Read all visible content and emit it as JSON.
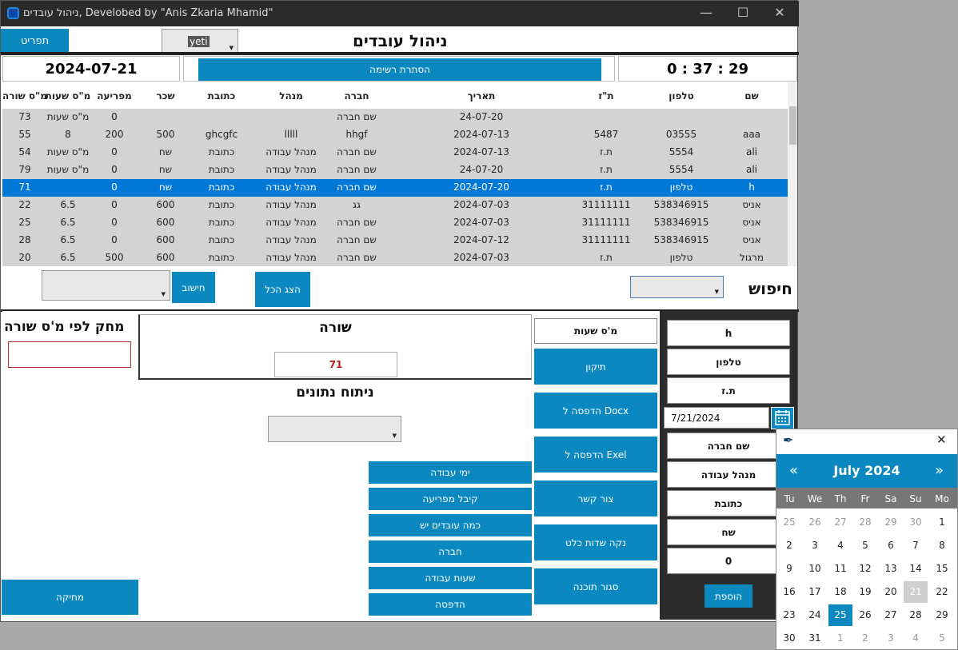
{
  "window": {
    "title": "ניהול עובדים, Develobed by \"Anis Zkaria Mhamid\""
  },
  "top": {
    "menu_button": "תפריט",
    "combo_value": "yeti",
    "app_title": "ניהול עובדים"
  },
  "info": {
    "date": "2024-07-21",
    "toggle_button": "הסתרת רשימה",
    "clock": "0 : 37 : 29"
  },
  "table": {
    "columns": [
      "שם",
      "טלפון",
      "ת\"ז",
      "תאריך",
      "חברה",
      "מנהל",
      "כתובת",
      "שכר",
      "מפריעה",
      "מ\"ס שעות",
      "מ\"ס שורה"
    ],
    "rows": [
      [
        "",
        "",
        "",
        "24-07-20",
        "שם חברה",
        "",
        "",
        "",
        "0",
        "מ\"ס שעות",
        "73"
      ],
      [
        "aaa",
        "03555",
        "5487",
        "2024-07-13",
        "hhgf",
        "lllll",
        "ghcgfc",
        "500",
        "200",
        "8",
        "55"
      ],
      [
        "ali",
        "5554",
        "ת.ז",
        "2024-07-13",
        "שם חברה",
        "מנהל עבודה",
        "כתובת",
        "שח",
        "0",
        "מ\"ס שעות",
        "54"
      ],
      [
        "ali",
        "5554",
        "ת.ז",
        "24-07-20",
        "שם חברה",
        "מנהל עבודה",
        "כתובת",
        "שח",
        "0",
        "מ\"ס שעות",
        "79"
      ],
      [
        "h",
        "טלפון",
        "ת.ז",
        "2024-07-20",
        "שם חברה",
        "מנהל עבודה",
        "כתובת",
        "שח",
        "0",
        "",
        "71"
      ],
      [
        "אניס",
        "538346915",
        "31111111",
        "2024-07-03",
        "גג",
        "מנהל עבודה",
        "כתובת",
        "600",
        "0",
        "6.5",
        "22"
      ],
      [
        "אניס",
        "538346915",
        "31111111",
        "2024-07-03",
        "שם חברה",
        "מנהל עבודה",
        "כתובת",
        "600",
        "0",
        "6.5",
        "25"
      ],
      [
        "אניס",
        "538346915",
        "31111111",
        "2024-07-12",
        "שם חברה",
        "מנהל עבודה",
        "כתובת",
        "600",
        "0",
        "6.5",
        "28"
      ],
      [
        "מרגול",
        "טלפון",
        "ת.ז",
        "2024-07-03",
        "שם חברה",
        "מנהל עבודה",
        "כתובת",
        "600",
        "500",
        "6.5",
        "20"
      ]
    ],
    "selected_row": 4
  },
  "search": {
    "label": "חיפוש",
    "show_all": "הצג הכל",
    "calc": "חישוב"
  },
  "delete_panel": {
    "title": "מחק לפי מ'ס שורה",
    "delete_button": "מחיקה"
  },
  "row_panel": {
    "title": "שורה",
    "value": "71"
  },
  "analysis": {
    "title": "ניתוח נתונים",
    "buttons": [
      "ימי עבודה",
      "קיבל מפריעה",
      "כמה עובדים יש",
      "חברה",
      "שעות עבודה",
      "הדפסה"
    ]
  },
  "actions": {
    "hours_box": "מ'ס שעות",
    "buttons": [
      "תיקון",
      "הדפסה ל Docx",
      "הדפסה ל Exel",
      "צור קשר",
      "נקה שדות כלט",
      "סגור תוכנה"
    ]
  },
  "form": {
    "fields": [
      "h",
      "טלפון",
      "ת.ז"
    ],
    "date": "7/21/2024",
    "fields2": [
      "שם חברה",
      "מנהל עבודה",
      "כתובת",
      "שח",
      "0"
    ],
    "add_button": "הוספת"
  },
  "calendar": {
    "month": "July 2024",
    "prev": "«",
    "next": "»",
    "weekdays": [
      "Tu",
      "We",
      "Th",
      "Fr",
      "Sa",
      "Su",
      "Mo"
    ],
    "weeks": [
      [
        "25",
        "26",
        "27",
        "28",
        "29",
        "30",
        "1"
      ],
      [
        "2",
        "3",
        "4",
        "5",
        "6",
        "7",
        "8"
      ],
      [
        "9",
        "10",
        "11",
        "12",
        "13",
        "14",
        "15"
      ],
      [
        "16",
        "17",
        "18",
        "19",
        "20",
        "21",
        "22"
      ],
      [
        "23",
        "24",
        "25",
        "26",
        "27",
        "28",
        "29"
      ],
      [
        "30",
        "31",
        "1",
        "2",
        "3",
        "4",
        "5"
      ]
    ],
    "selected": "25",
    "today": "21",
    "accent": "#0a88bf"
  }
}
